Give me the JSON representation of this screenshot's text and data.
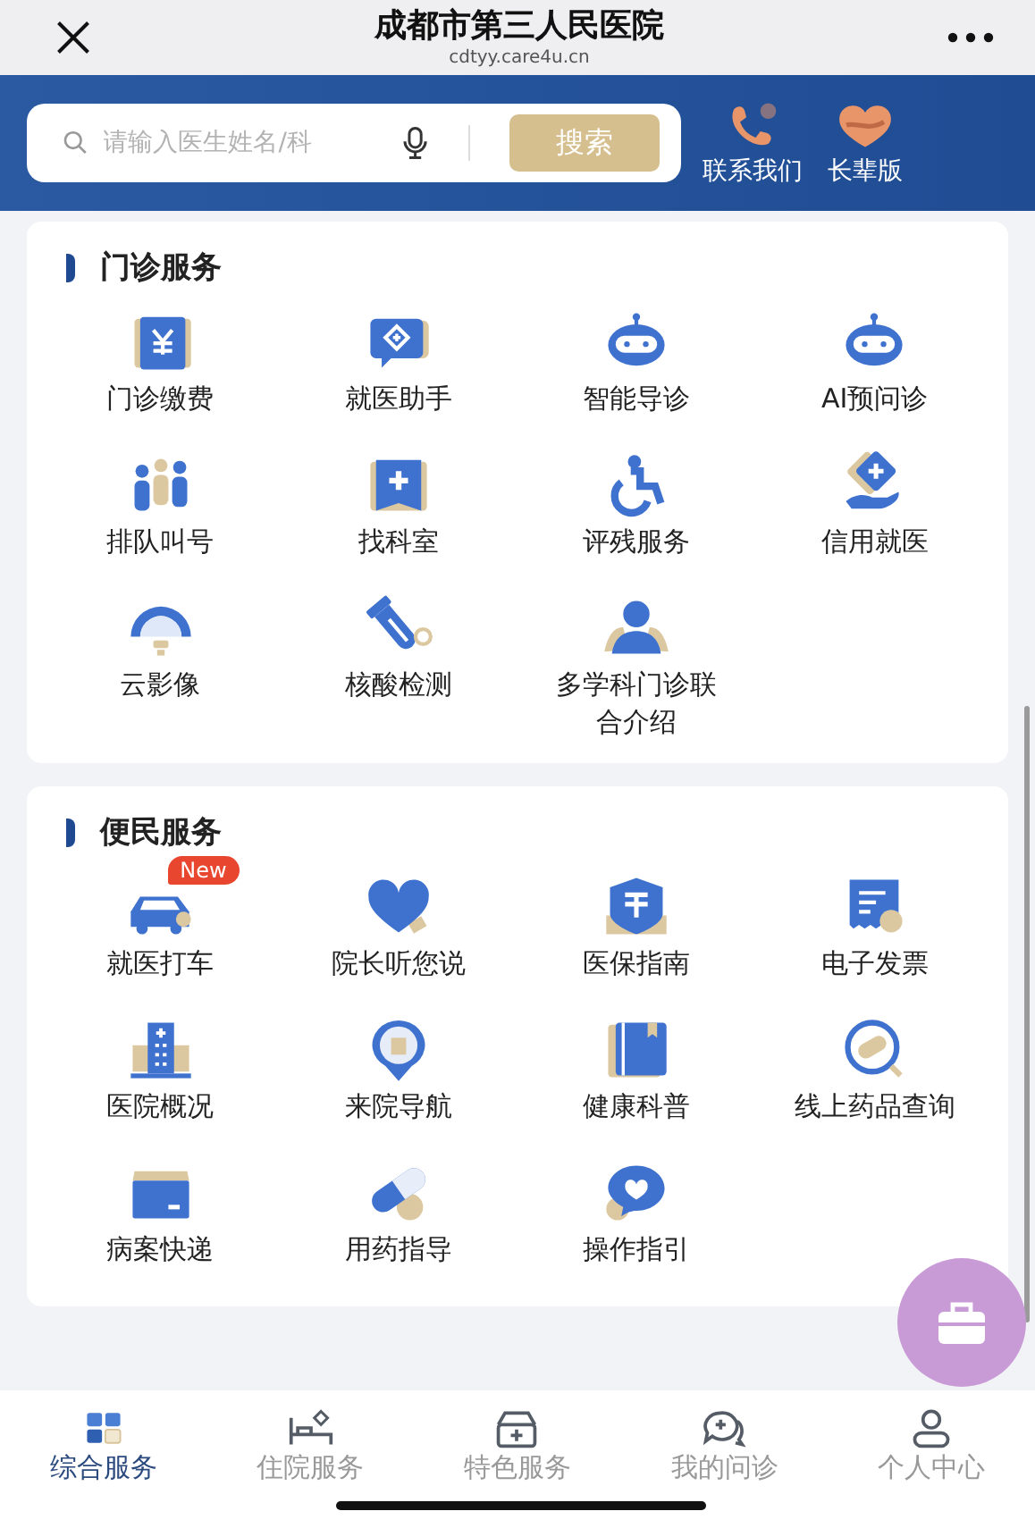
{
  "header": {
    "title": "成都市第三人民医院",
    "url": "cdtyy.care4u.cn"
  },
  "search": {
    "placeholder": "请输入医生姓名/科",
    "button": "搜索"
  },
  "quick_links": [
    {
      "label": "联系我们"
    },
    {
      "label": "长辈版"
    }
  ],
  "sections": [
    {
      "title": "门诊服务",
      "items": [
        {
          "label": "门诊缴费"
        },
        {
          "label": "就医助手"
        },
        {
          "label": "智能导诊"
        },
        {
          "label": "AI预问诊"
        },
        {
          "label": "排队叫号"
        },
        {
          "label": "找科室"
        },
        {
          "label": "评残服务"
        },
        {
          "label": "信用就医"
        },
        {
          "label": "云影像"
        },
        {
          "label": "核酸检测"
        },
        {
          "label": "多学科门诊联合介绍"
        }
      ]
    },
    {
      "title": "便民服务",
      "items": [
        {
          "label": "就医打车",
          "badge": "New"
        },
        {
          "label": "院长听您说"
        },
        {
          "label": "医保指南"
        },
        {
          "label": "电子发票"
        },
        {
          "label": "医院概况"
        },
        {
          "label": "来院导航"
        },
        {
          "label": "健康科普"
        },
        {
          "label": "线上药品查询"
        },
        {
          "label": "病案快递"
        },
        {
          "label": "用药指导"
        },
        {
          "label": "操作指引"
        }
      ]
    }
  ],
  "tabs": [
    {
      "label": "综合服务",
      "selected": true
    },
    {
      "label": "住院服务",
      "selected": false
    },
    {
      "label": "特色服务",
      "selected": false
    },
    {
      "label": "我的问诊",
      "selected": false
    },
    {
      "label": "个人中心",
      "selected": false
    }
  ]
}
